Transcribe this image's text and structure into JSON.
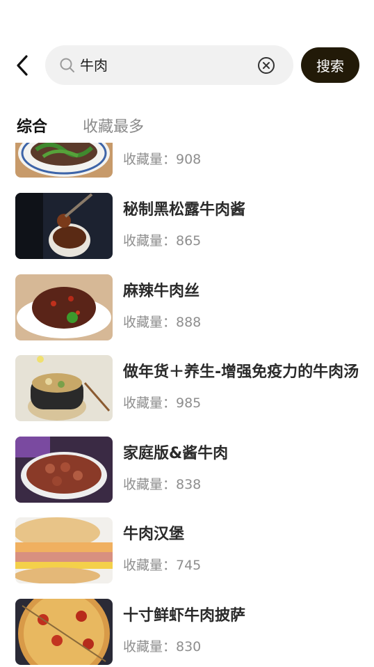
{
  "header": {
    "search_query": "牛肉",
    "search_button": "搜索"
  },
  "tabs": [
    {
      "label": "综合",
      "active": true
    },
    {
      "label": "收藏最多",
      "active": false
    }
  ],
  "fav_prefix": "收藏量：",
  "recipes": [
    {
      "title": "",
      "favorites": "收藏量：908"
    },
    {
      "title": "秘制黑松露牛肉酱",
      "favorites": "收藏量：865"
    },
    {
      "title": "麻辣牛肉丝",
      "favorites": "收藏量：888"
    },
    {
      "title": "做年货＋养生-增强免疫力的牛肉汤",
      "favorites": "收藏量：985"
    },
    {
      "title": "家庭版&酱牛肉",
      "favorites": "收藏量：838"
    },
    {
      "title": "牛肉汉堡",
      "favorites": "收藏量：745"
    },
    {
      "title": "十寸鲜虾牛肉披萨",
      "favorites": "收藏量：830"
    }
  ],
  "colors": {
    "accent_button": "#221a08",
    "search_bg": "#f1f1f1",
    "muted_text": "#8e8e8e"
  }
}
